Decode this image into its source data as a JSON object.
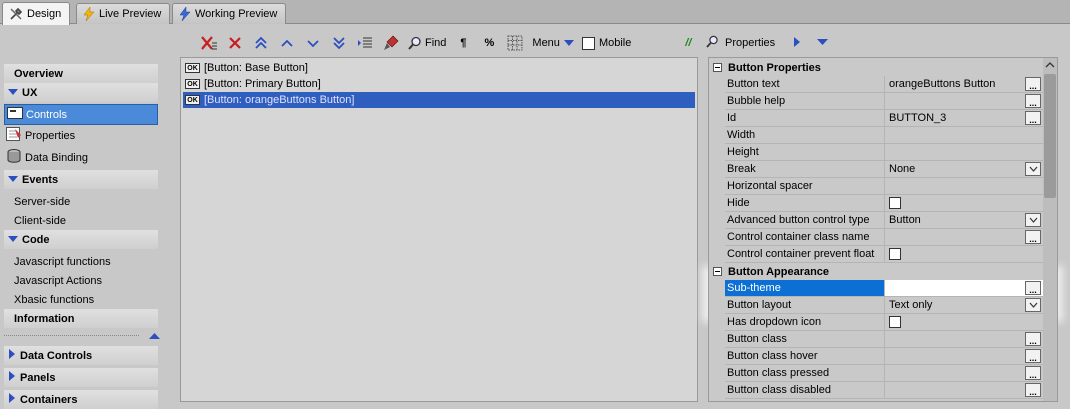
{
  "tabs": [
    {
      "label": "Design",
      "icon": "tools-icon"
    },
    {
      "label": "Live Preview",
      "icon": "lightning-icon"
    },
    {
      "label": "Working Preview",
      "icon": "lightning-icon"
    }
  ],
  "toolbar": {
    "find_label": "Find",
    "pilcrow": "¶",
    "percent": "%",
    "menu_label": "Menu",
    "mobile_label": "Mobile",
    "slashes": "//"
  },
  "sidebar": {
    "overview": "Overview",
    "ux": "UX",
    "controls": "Controls",
    "properties": "Properties",
    "data_binding": "Data Binding",
    "events": "Events",
    "server_side": "Server-side",
    "client_side": "Client-side",
    "code": "Code",
    "js_functions": "Javascript functions",
    "js_actions": "Javascript Actions",
    "xbasic_functions": "Xbasic functions",
    "information": "Information",
    "data_controls": "Data Controls",
    "panels": "Panels",
    "containers": "Containers"
  },
  "list": {
    "items": [
      "[Button: Base Button]",
      "[Button: Primary Button]",
      "[Button: orangeButtons Button]"
    ],
    "badge": "OK"
  },
  "properties_panel": {
    "title": "Properties",
    "sections": {
      "button_properties": "Button Properties",
      "button_appearance": "Button Appearance"
    },
    "rows": {
      "button_text": {
        "name": "Button text",
        "value": "orangeButtons Button"
      },
      "bubble_help": {
        "name": "Bubble help",
        "value": ""
      },
      "id": {
        "name": "Id",
        "value": "BUTTON_3"
      },
      "width": {
        "name": "Width",
        "value": ""
      },
      "height": {
        "name": "Height",
        "value": ""
      },
      "break": {
        "name": "Break",
        "value": "None"
      },
      "horizontal_spacer": {
        "name": "Horizontal spacer",
        "value": ""
      },
      "hide": {
        "name": "Hide",
        "value": ""
      },
      "advanced_type": {
        "name": "Advanced button control type",
        "value": "Button"
      },
      "container_class": {
        "name": "Control container class name",
        "value": ""
      },
      "container_float": {
        "name": "Control container prevent float",
        "value": ""
      },
      "sub_theme": {
        "name": "Sub-theme",
        "value": ""
      },
      "button_layout": {
        "name": "Button layout",
        "value": "Text only"
      },
      "has_dropdown": {
        "name": "Has dropdown icon",
        "value": ""
      },
      "button_class": {
        "name": "Button class",
        "value": ""
      },
      "button_class_hover": {
        "name": "Button class hover",
        "value": ""
      },
      "button_class_pressed": {
        "name": "Button class pressed",
        "value": ""
      },
      "button_class_disabled": {
        "name": "Button class disabled",
        "value": ""
      }
    },
    "ellipsis": "..."
  },
  "colors": {
    "selection_blue": "#2f5fbe",
    "sidebar_selected": "#4a8ad8",
    "property_selected": "#0b6fd4",
    "delete_red": "#c81e1e",
    "arrow_blue": "#2c4fbf"
  }
}
